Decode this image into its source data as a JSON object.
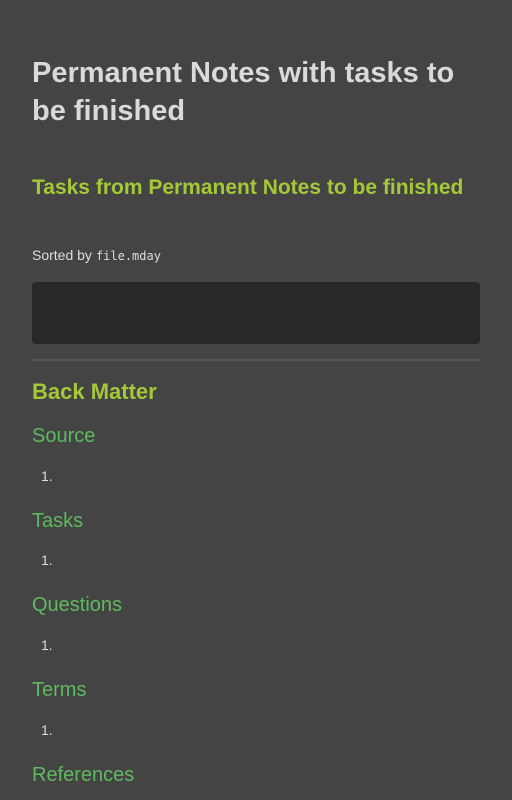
{
  "note": {
    "title": "Permanent Notes with tasks to be finished",
    "tasks_heading": "Tasks from Permanent Notes to be finished",
    "sorted_by_label": "Sorted by",
    "sorted_by_field": "file.mday",
    "back_matter_heading": "Back Matter",
    "sections": [
      {
        "heading": "Source",
        "item_marker": "1."
      },
      {
        "heading": "Tasks",
        "item_marker": "1."
      },
      {
        "heading": "Questions",
        "item_marker": "1."
      },
      {
        "heading": "Terms",
        "item_marker": "1."
      },
      {
        "heading": "References"
      }
    ]
  }
}
